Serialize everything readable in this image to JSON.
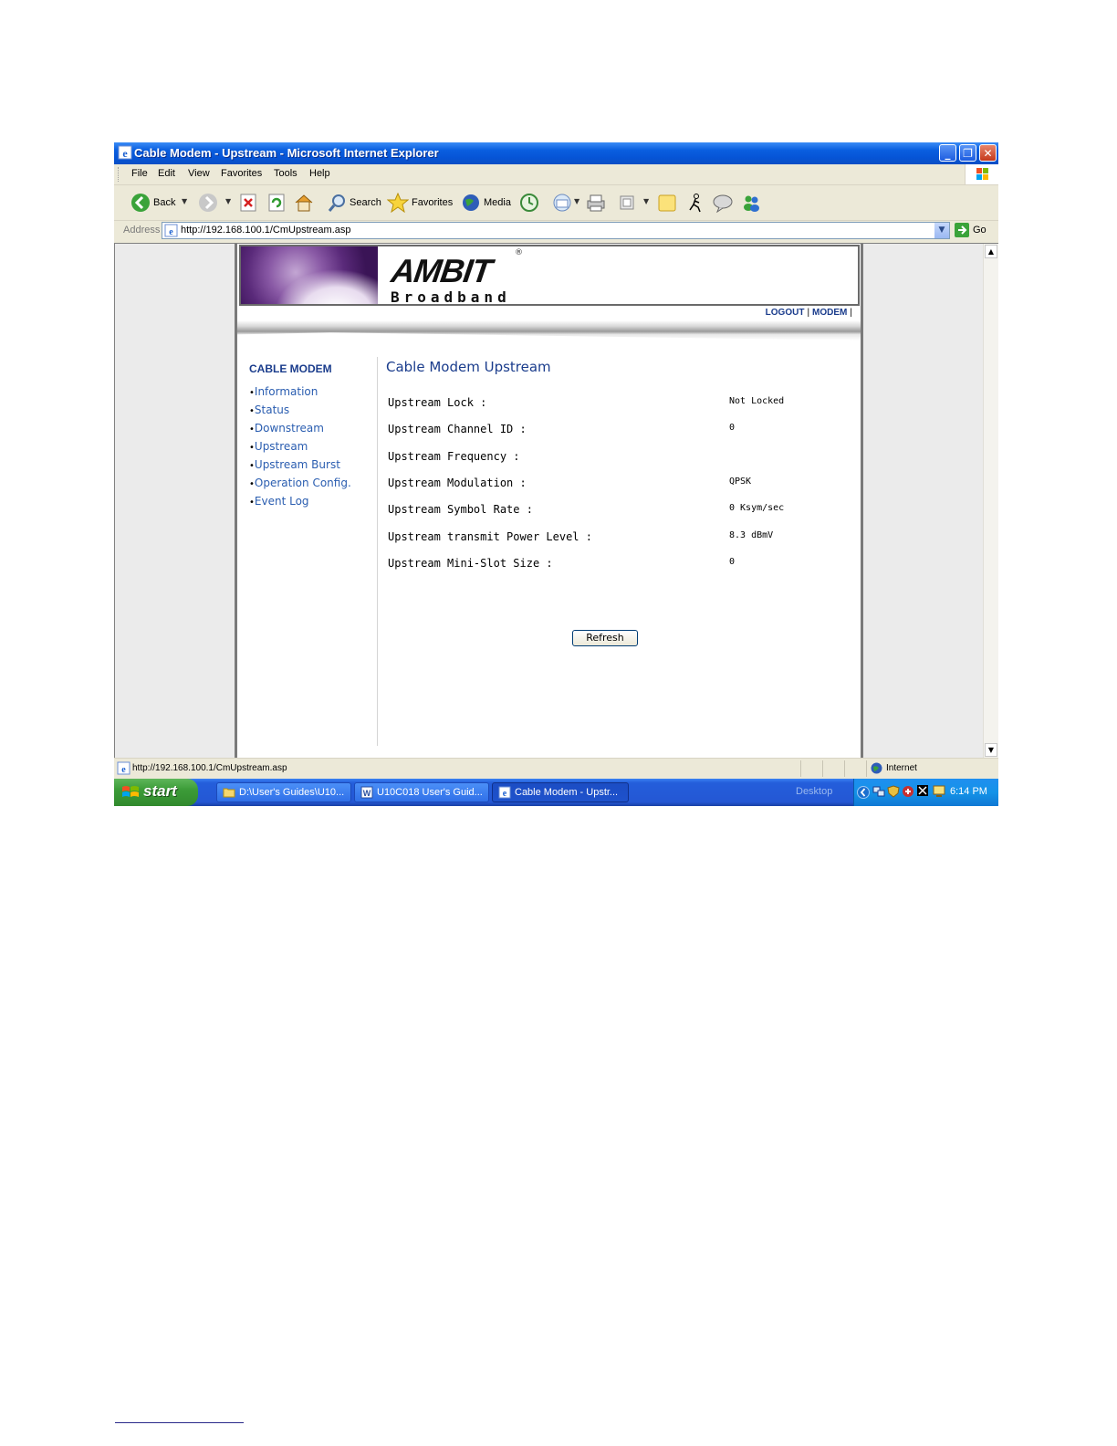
{
  "window": {
    "title": "Cable Modem - Upstream - Microsoft Internet Explorer"
  },
  "menu": [
    "File",
    "Edit",
    "View",
    "Favorites",
    "Tools",
    "Help"
  ],
  "toolbar": {
    "back": "Back",
    "search": "Search",
    "favorites": "Favorites",
    "media": "Media"
  },
  "address": {
    "label": "Address",
    "url": "http://192.168.100.1/CmUpstream.asp",
    "go": "Go"
  },
  "banner": {
    "brand": "AMBIT",
    "brand_mark": "®",
    "tagline": "Broadband"
  },
  "toplinks": {
    "logout": "LOGOUT",
    "modem": "MODEM",
    "sep": "|"
  },
  "sidebar": {
    "heading": "CABLE MODEM",
    "items": [
      "Information",
      "Status",
      "Downstream",
      "Upstream",
      "Upstream Burst",
      "Operation Config.",
      "Event Log"
    ]
  },
  "main": {
    "title": "Cable Modem Upstream",
    "rows": [
      {
        "label": "Upstream Lock :",
        "value": "Not Locked"
      },
      {
        "label": "Upstream Channel ID :",
        "value": "0"
      },
      {
        "label": "Upstream Frequency :",
        "value": ""
      },
      {
        "label": "Upstream Modulation :",
        "value": "QPSK"
      },
      {
        "label": "Upstream Symbol Rate :",
        "value": "0 Ksym/sec"
      },
      {
        "label": "Upstream transmit Power Level :",
        "value": "8.3 dBmV"
      },
      {
        "label": "Upstream Mini-Slot Size :",
        "value": "0"
      }
    ],
    "refresh": "Refresh"
  },
  "statusbar": {
    "text": "http://192.168.100.1/CmUpstream.asp",
    "zone": "Internet"
  },
  "taskbar": {
    "start": "start",
    "tasks": [
      "D:\\User's Guides\\U10...",
      "U10C018 User's Guid...",
      "Cable Modem - Upstr..."
    ],
    "desktop": "Desktop",
    "clock": "6:14 PM"
  },
  "colors": {
    "titlebar": "#0a5fe0",
    "link": "#2a5db0",
    "heading": "#1a3c8c",
    "start": "#3c9c38"
  }
}
